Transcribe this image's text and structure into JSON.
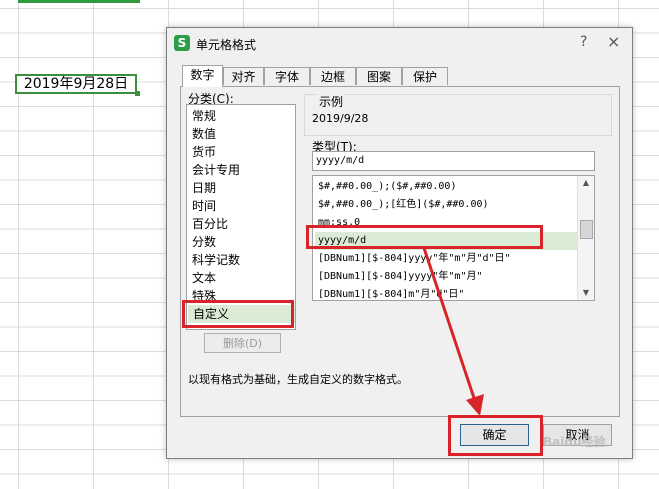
{
  "sheet": {
    "cell_value": "2019年9月28日"
  },
  "dialog": {
    "title": "单元格格式",
    "app_icon": "S",
    "help_icon": "?",
    "close_icon": "×",
    "tabs": [
      {
        "label": "数字",
        "active": true
      },
      {
        "label": "对齐"
      },
      {
        "label": "字体"
      },
      {
        "label": "边框"
      },
      {
        "label": "图案"
      },
      {
        "label": "保护"
      }
    ],
    "category_label": "分类(C):",
    "categories": [
      "常规",
      "数值",
      "货币",
      "会计专用",
      "日期",
      "时间",
      "百分比",
      "分数",
      "科学记数",
      "文本",
      "特殊",
      "自定义"
    ],
    "selected_category": "自定义",
    "delete_label": "删除(D)",
    "sample_label": "示例",
    "sample_value": "2019/9/28",
    "type_label": "类型(T):",
    "type_value": "yyyy/m/d",
    "formats": [
      "$#,##0.00_);($#,##0.00)",
      "$#,##0.00_);[红色]($#,##0.00)",
      "mm:ss.0",
      "yyyy/m/d",
      "[DBNum1][$-804]yyyy\"年\"m\"月\"d\"日\"",
      "[DBNum1][$-804]yyyy\"年\"m\"月\"",
      "[DBNum1][$-804]m\"月\"d\"日\""
    ],
    "selected_format": "yyyy/m/d",
    "description": "以现有格式为基础，生成自定义的数字格式。",
    "ok_label": "确定",
    "cancel_label": "取消"
  },
  "watermark": "Baidu经验",
  "colors": {
    "highlight": "#d8232a",
    "selection": "#dcebd5",
    "grid": "#dcdcdc",
    "app_green": "#2e9d48"
  }
}
